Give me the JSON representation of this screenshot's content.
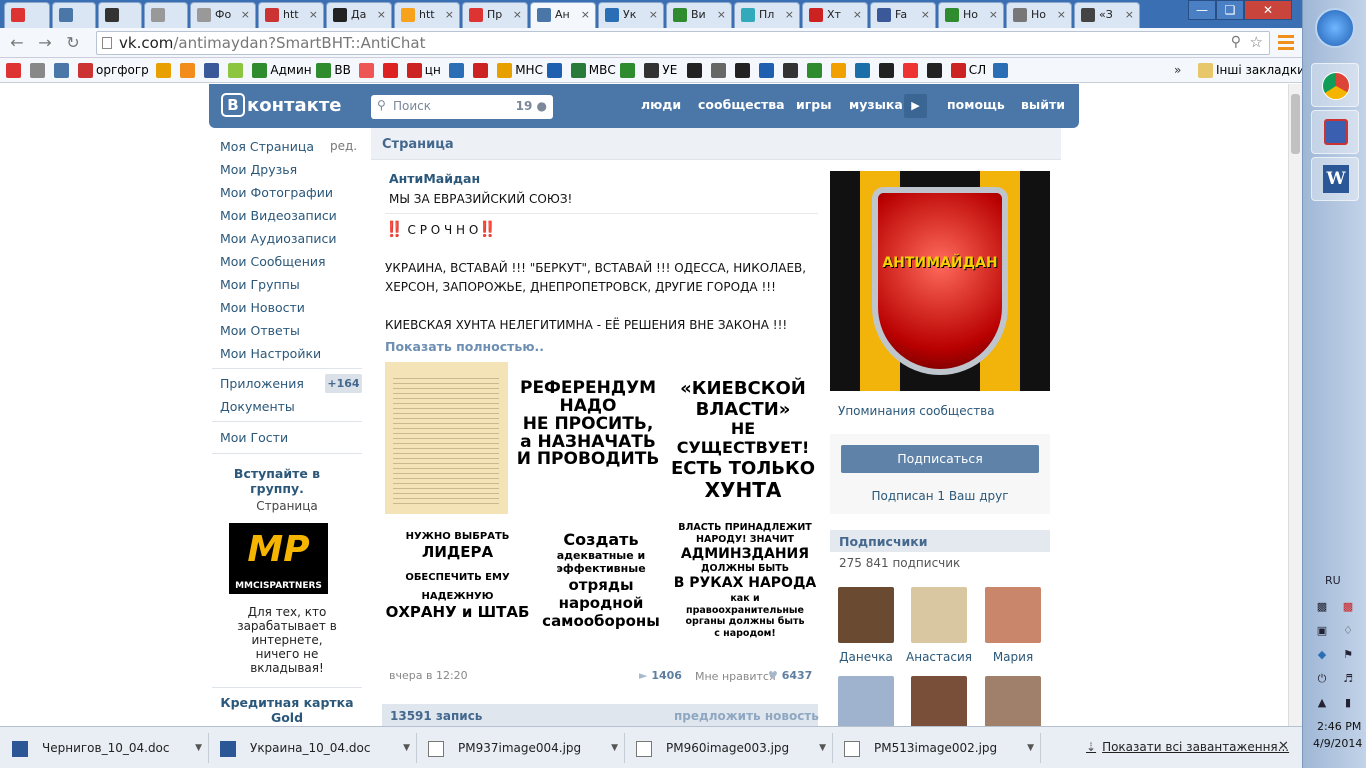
{
  "browser": {
    "tabs": [
      {
        "label": "",
        "icon": "opera-icon",
        "color": "#d33"
      },
      {
        "label": "",
        "icon": "vk-icon",
        "color": "#4a76a8"
      },
      {
        "label": "",
        "icon": "h-icon",
        "color": "#333"
      },
      {
        "label": "",
        "icon": "doc-icon",
        "color": "#999"
      },
      {
        "label": "Фо",
        "icon": "doc-icon",
        "color": "#999"
      },
      {
        "label": "htt",
        "icon": "at-icon",
        "color": "#c33"
      },
      {
        "label": "Да",
        "icon": "bars-icon",
        "color": "#222"
      },
      {
        "label": "htt",
        "icon": "cloud-icon",
        "color": "#f6a21a"
      },
      {
        "label": "Пр",
        "icon": "gmail-icon",
        "color": "#d33"
      },
      {
        "label": "Ан",
        "icon": "vk-icon",
        "color": "#4a76a8",
        "active": true
      },
      {
        "label": "Ук",
        "icon": "ua-icon",
        "color": "#2a6fb6"
      },
      {
        "label": "Ви",
        "icon": "vv-icon",
        "color": "#2e8b2e"
      },
      {
        "label": "Пл",
        "icon": "pl-icon",
        "color": "#3ab"
      },
      {
        "label": "Хт",
        "icon": "up-icon",
        "color": "#c22"
      },
      {
        "label": "Fa",
        "icon": "facebook-icon",
        "color": "#3b5998"
      },
      {
        "label": "Но",
        "icon": "vv-icon",
        "color": "#2e8b2e"
      },
      {
        "label": "Но",
        "icon": "globe-icon",
        "color": "#777"
      },
      {
        "label": "«З",
        "icon": "pik-icon",
        "color": "#444"
      }
    ],
    "url_host": "vk.com",
    "url_path": "/antimaydan?SmartBHT::AntiChat",
    "bookmarks": [
      {
        "label": "",
        "icon": "gmail-icon",
        "color": "#d33"
      },
      {
        "label": "",
        "icon": "globe-icon",
        "color": "#888"
      },
      {
        "label": "",
        "icon": "vk-icon",
        "color": "#4a76a8"
      },
      {
        "label": "оргфогр",
        "icon": "bookmark-icon",
        "color": "#c33"
      },
      {
        "label": "",
        "icon": "key-icon",
        "color": "#e8a000"
      },
      {
        "label": "",
        "icon": "ok-icon",
        "color": "#f28c1a"
      },
      {
        "label": "",
        "icon": "facebook-icon",
        "color": "#3b5998"
      },
      {
        "label": "",
        "icon": "android-icon",
        "color": "#8cc63f"
      },
      {
        "label": "Админ",
        "icon": "vv-icon",
        "color": "#2e8b2e"
      },
      {
        "label": "ВВ",
        "icon": "vv-icon",
        "color": "#2e8b2e"
      },
      {
        "label": "",
        "icon": "star-icon",
        "color": "#e55"
      },
      {
        "label": "",
        "icon": "youtube-icon",
        "color": "#d22"
      },
      {
        "label": "цн",
        "icon": "cn-icon",
        "color": "#c22"
      },
      {
        "label": "",
        "icon": "pencil-icon",
        "color": "#2a6fb6"
      },
      {
        "label": "",
        "icon": "up-icon",
        "color": "#c22"
      },
      {
        "label": "МНС",
        "icon": "mns-icon",
        "color": "#e8a000"
      },
      {
        "label": "",
        "icon": "trident-icon",
        "color": "#1f5fb0"
      },
      {
        "label": "МВС",
        "icon": "mvs-icon",
        "color": "#2a7a3a"
      },
      {
        "label": "",
        "icon": "signal-icon",
        "color": "#2e8b2e"
      },
      {
        "label": "УЕ",
        "icon": "ue-icon",
        "color": "#333"
      },
      {
        "label": "",
        "icon": "bbc-icon",
        "color": "#222"
      },
      {
        "label": "",
        "icon": "bird-icon",
        "color": "#666"
      },
      {
        "label": "",
        "icon": "eagle-icon",
        "color": "#222"
      },
      {
        "label": "",
        "icon": "trident-icon",
        "color": "#1f5fb0"
      },
      {
        "label": "",
        "icon": "un-icon",
        "color": "#333"
      },
      {
        "label": "",
        "icon": "signal-icon",
        "color": "#2e8b2e"
      },
      {
        "label": "",
        "icon": "grid-icon",
        "color": "#f0a000"
      },
      {
        "label": "",
        "icon": "c-icon",
        "color": "#1a6fa8"
      },
      {
        "label": "",
        "icon": "stack-icon",
        "color": "#222"
      },
      {
        "label": "",
        "icon": "f-icon",
        "color": "#e33"
      },
      {
        "label": "",
        "icon": "bars-icon",
        "color": "#222"
      },
      {
        "label": "СЛ",
        "icon": "up-icon",
        "color": "#c22"
      },
      {
        "label": "",
        "icon": "u-icon",
        "color": "#2a6fb6"
      }
    ],
    "other_bookmarks": "Інші закладки",
    "overflow": "»"
  },
  "vk": {
    "logo": "контакте",
    "logo_letter": "В",
    "search_placeholder": "Поиск",
    "search_count": "19",
    "nav": [
      "люди",
      "сообщества",
      "игры",
      "музыка",
      "помощь",
      "выйти"
    ],
    "left_menu": [
      "Моя Страница",
      "Мои Друзья",
      "Мои Фотографии",
      "Мои Видеозаписи",
      "Мои Аудиозаписи",
      "Мои Сообщения",
      "Мои Группы",
      "Мои Новости",
      "Мои Ответы",
      "Мои Настройки"
    ],
    "edit_label": "ред.",
    "apps_label": "Приложения",
    "apps_badge": "+164",
    "docs_label": "Документы",
    "guests_label": "Мои Гости",
    "ad": {
      "title": "Вступайте в группу.",
      "subtitle": "Страница",
      "logo_text": "MP",
      "logo_sub": "MMCISPARTNERS",
      "text": "Для тех, кто зарабатывает в интернете, ничего не вкладывая!",
      "title2": "Кредитная картка Gold"
    },
    "page_header": "Страница",
    "group_name": "АнтиМайдан",
    "status": "МЫ ЗА ЕВРАЗИЙСКИЙ СОЮЗ!",
    "post": {
      "urgent": "С Р О Ч Н О",
      "urgent_mark": "‼️",
      "line1": "УКРАИНА, ВСТАВАЙ !!! \"БЕРКУТ\", ВСТАВАЙ !!! ОДЕССА, НИКОЛАЕВ,",
      "line2": "ХЕРСОН, ЗАПОРОЖЬЕ, ДНЕПРОПЕТРОВСК, ДРУГИЕ ГОРОДА !!!",
      "line3": "КИЕВСКАЯ ХУНТА НЕЛЕГИТИМНА - ЕЁ РЕШЕНИЯ ВНЕ ЗАКОНА !!!",
      "show_more": "Показать полностью..",
      "images": [
        {
          "lines": [
            "РЕФЕРЕНДУМ",
            "НАДО",
            "НЕ ПРОСИТЬ,",
            "а НАЗНАЧАТЬ",
            "И ПРОВОДИТЬ"
          ]
        },
        {
          "lines": [
            "«КИЕВСКОЙ",
            "ВЛАСТИ»",
            "НЕ СУЩЕСТВУЕТ!",
            "ЕСТЬ ТОЛЬКО",
            "ХУНТА"
          ]
        },
        {
          "lines": [
            "НУЖНО ВЫБРАТЬ",
            "ЛИДЕРА",
            "ОБЕСПЕЧИТЬ ЕМУ",
            "НАДЕЖНУЮ",
            "ОХРАНУ и ШТАБ"
          ]
        },
        {
          "lines": [
            "Создать",
            "адекватные и",
            "эффективные",
            "отряды",
            "народной",
            "самообороны"
          ]
        },
        {
          "lines": [
            "ВЛАСТЬ ПРИНАДЛЕЖИТ",
            "НАРОДУ! ЗНАЧИТ",
            "АДМИНЗДАНИЯ",
            "ДОЛЖНЫ БЫТЬ",
            "В РУКАХ НАРОДА",
            "как и",
            "правоохранительные",
            "органы должны быть",
            "с народом!"
          ]
        }
      ],
      "time": "вчера в 12:20",
      "reposts": "1406",
      "like_label": "Мне нравится",
      "likes": "6437"
    },
    "records": "13591 запись",
    "suggest": "предложить новость",
    "avatar_text": "АНТИМАЙДАН",
    "mentions": "Упоминания сообщества",
    "subscribe_btn": "Подписаться",
    "subscribed_friend": "Подписан 1 Ваш друг",
    "followers_title": "Подписчики",
    "followers_count": "275 841 подписчик",
    "followers": [
      {
        "name": "Данечка",
        "color": "#6a4a30"
      },
      {
        "name": "Анастасия",
        "color": "#d8c7a0"
      },
      {
        "name": "Мария",
        "color": "#c9866a"
      }
    ],
    "followers_row2_colors": [
      "#9fb3cf",
      "#7a4f3a",
      "#a0806a"
    ]
  },
  "downloads": [
    {
      "name": "Чернигов_10_04.doc",
      "icon": "word-icon"
    },
    {
      "name": "Украина_10_04.doc",
      "icon": "word-icon"
    },
    {
      "name": "PM937image004.jpg",
      "icon": "image-icon"
    },
    {
      "name": "PM960image003.jpg",
      "icon": "image-icon"
    },
    {
      "name": "PM513image002.jpg",
      "icon": "image-icon"
    }
  ],
  "show_all_downloads": "Показати всі завантаження...",
  "tray": {
    "lang": "RU",
    "time": "2:46 PM",
    "date": "4/9/2014"
  }
}
